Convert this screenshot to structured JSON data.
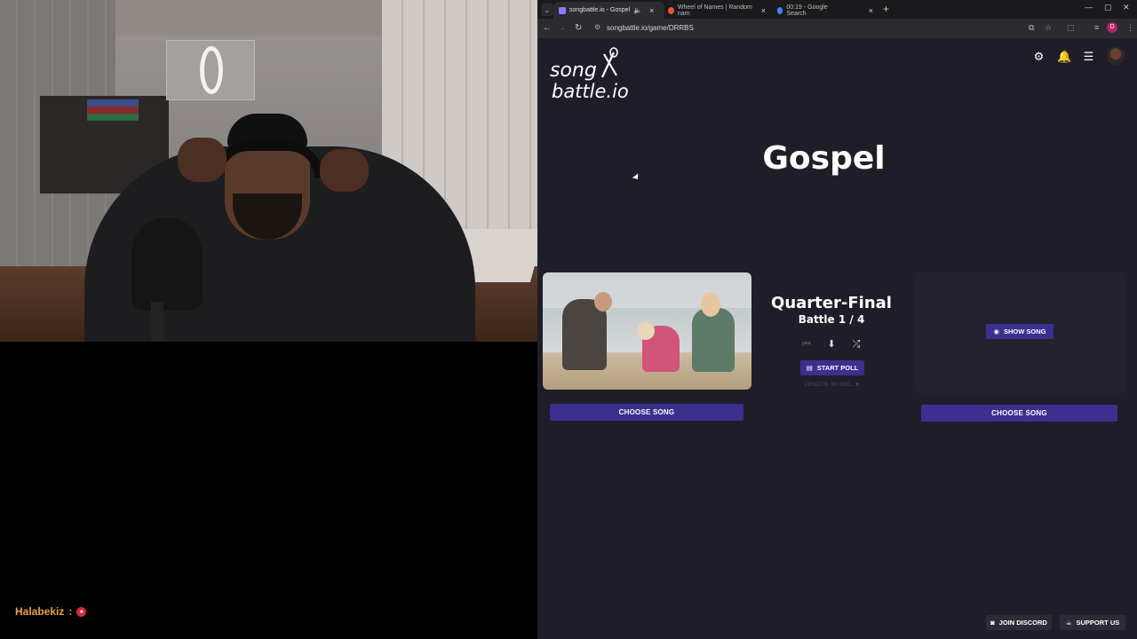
{
  "stream": {
    "chat": {
      "username": "Halabekiz",
      "separator": ":"
    }
  },
  "browser": {
    "tabs": [
      {
        "title": "songbattle.io - Gospel",
        "active": true,
        "favicon_color": "#8a7cff"
      },
      {
        "title": "Wheel of Names | Random nam",
        "active": false,
        "favicon_color": "#e4572e"
      },
      {
        "title": "00:19 - Google Search",
        "active": false,
        "favicon_color": "#4285f4"
      }
    ],
    "new_tab_label": "+",
    "url": "songbattle.io/game/DRRBS",
    "profile_initial": "D"
  },
  "page": {
    "logo": {
      "line1": "song",
      "line2": "battle.io"
    },
    "category_title": "Gospel",
    "round_name": "Quarter-Final",
    "battle_progress": "Battle 1 / 4",
    "buttons": {
      "choose_song_left": "CHOOSE SONG",
      "choose_song_right": "CHOOSE SONG",
      "start_poll": "START POLL",
      "show_song": "SHOW SONG",
      "join_discord": "JOIN DISCORD",
      "support_us": "SUPPORT US"
    },
    "length_label": "LENGTH: 60 SEC. ▼"
  },
  "colors": {
    "accent": "#3b2f8f",
    "page_bg": "#1f1e28",
    "chat_name": "#e8a24a"
  }
}
